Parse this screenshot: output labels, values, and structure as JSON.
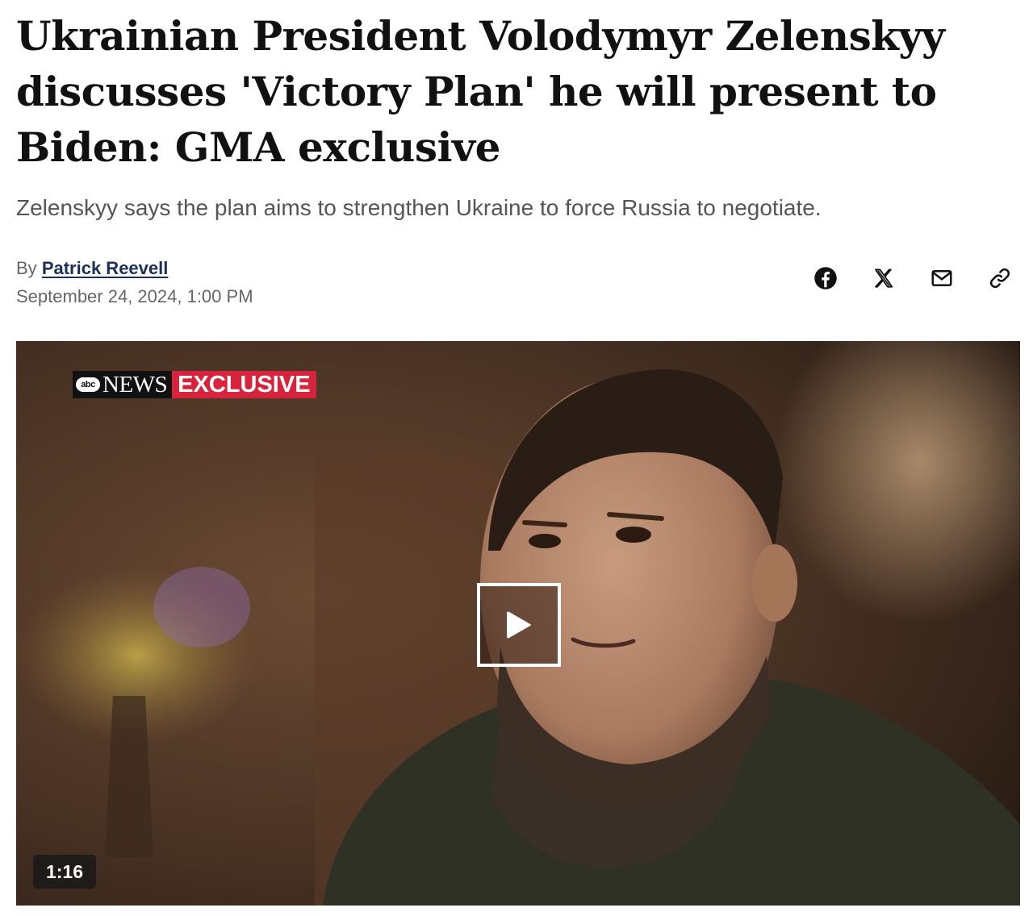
{
  "article": {
    "headline": "Ukrainian President Volodymyr Zelenskyy discusses 'Victory Plan' he will present to Biden: GMA exclusive",
    "subheadline": "Zelenskyy says the plan aims to strengthen Ukraine to force Russia to negotiate.",
    "byline_prefix": "By",
    "author": "Patrick Reevell",
    "date": "September 24, 2024, 1:00 PM"
  },
  "share": {
    "icons": [
      "facebook-icon",
      "x-icon",
      "mail-icon",
      "link-icon"
    ]
  },
  "video": {
    "badge_logo": "abc",
    "badge_news": "NEWS",
    "badge_exclusive": "EXCLUSIVE",
    "duration": "1:16",
    "colors": {
      "exclusive_red": "#d7233b",
      "badge_black": "#111111"
    }
  }
}
